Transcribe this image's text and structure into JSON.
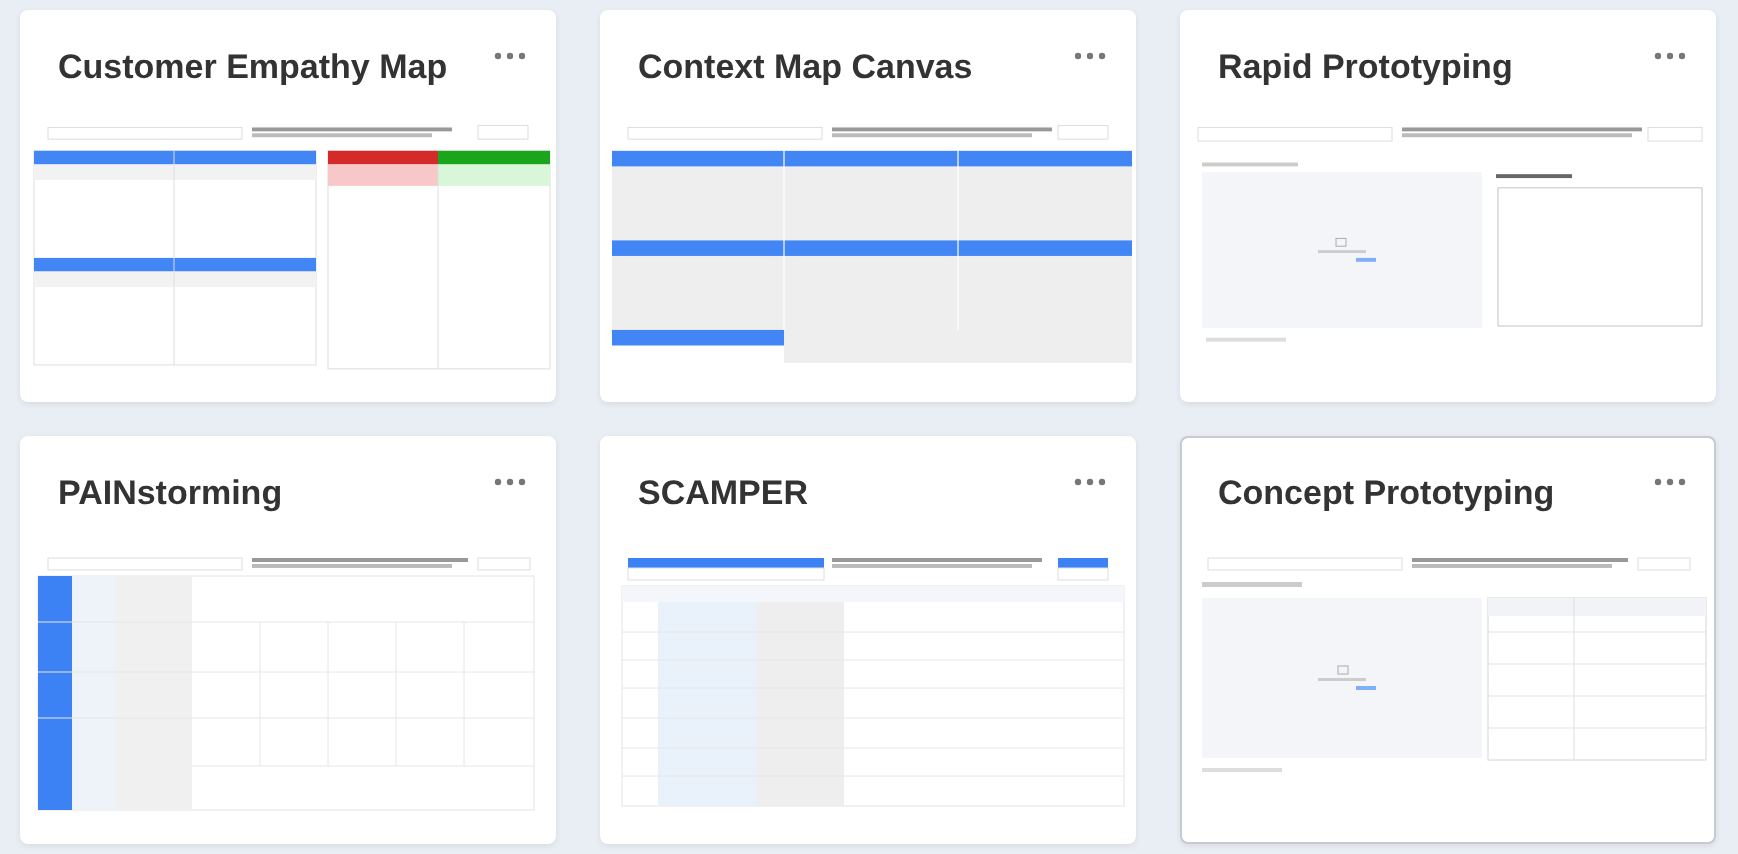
{
  "cards": [
    {
      "title": "Customer Empathy Map",
      "kind": "empathy",
      "selected": false
    },
    {
      "title": "Context Map Canvas",
      "kind": "context",
      "selected": false
    },
    {
      "title": "Rapid Prototyping",
      "kind": "prototype",
      "selected": false
    },
    {
      "title": "PAINstorming",
      "kind": "pain",
      "selected": false
    },
    {
      "title": "SCAMPER",
      "kind": "scamper",
      "selected": false
    },
    {
      "title": "Concept Prototyping",
      "kind": "concept",
      "selected": true
    }
  ]
}
